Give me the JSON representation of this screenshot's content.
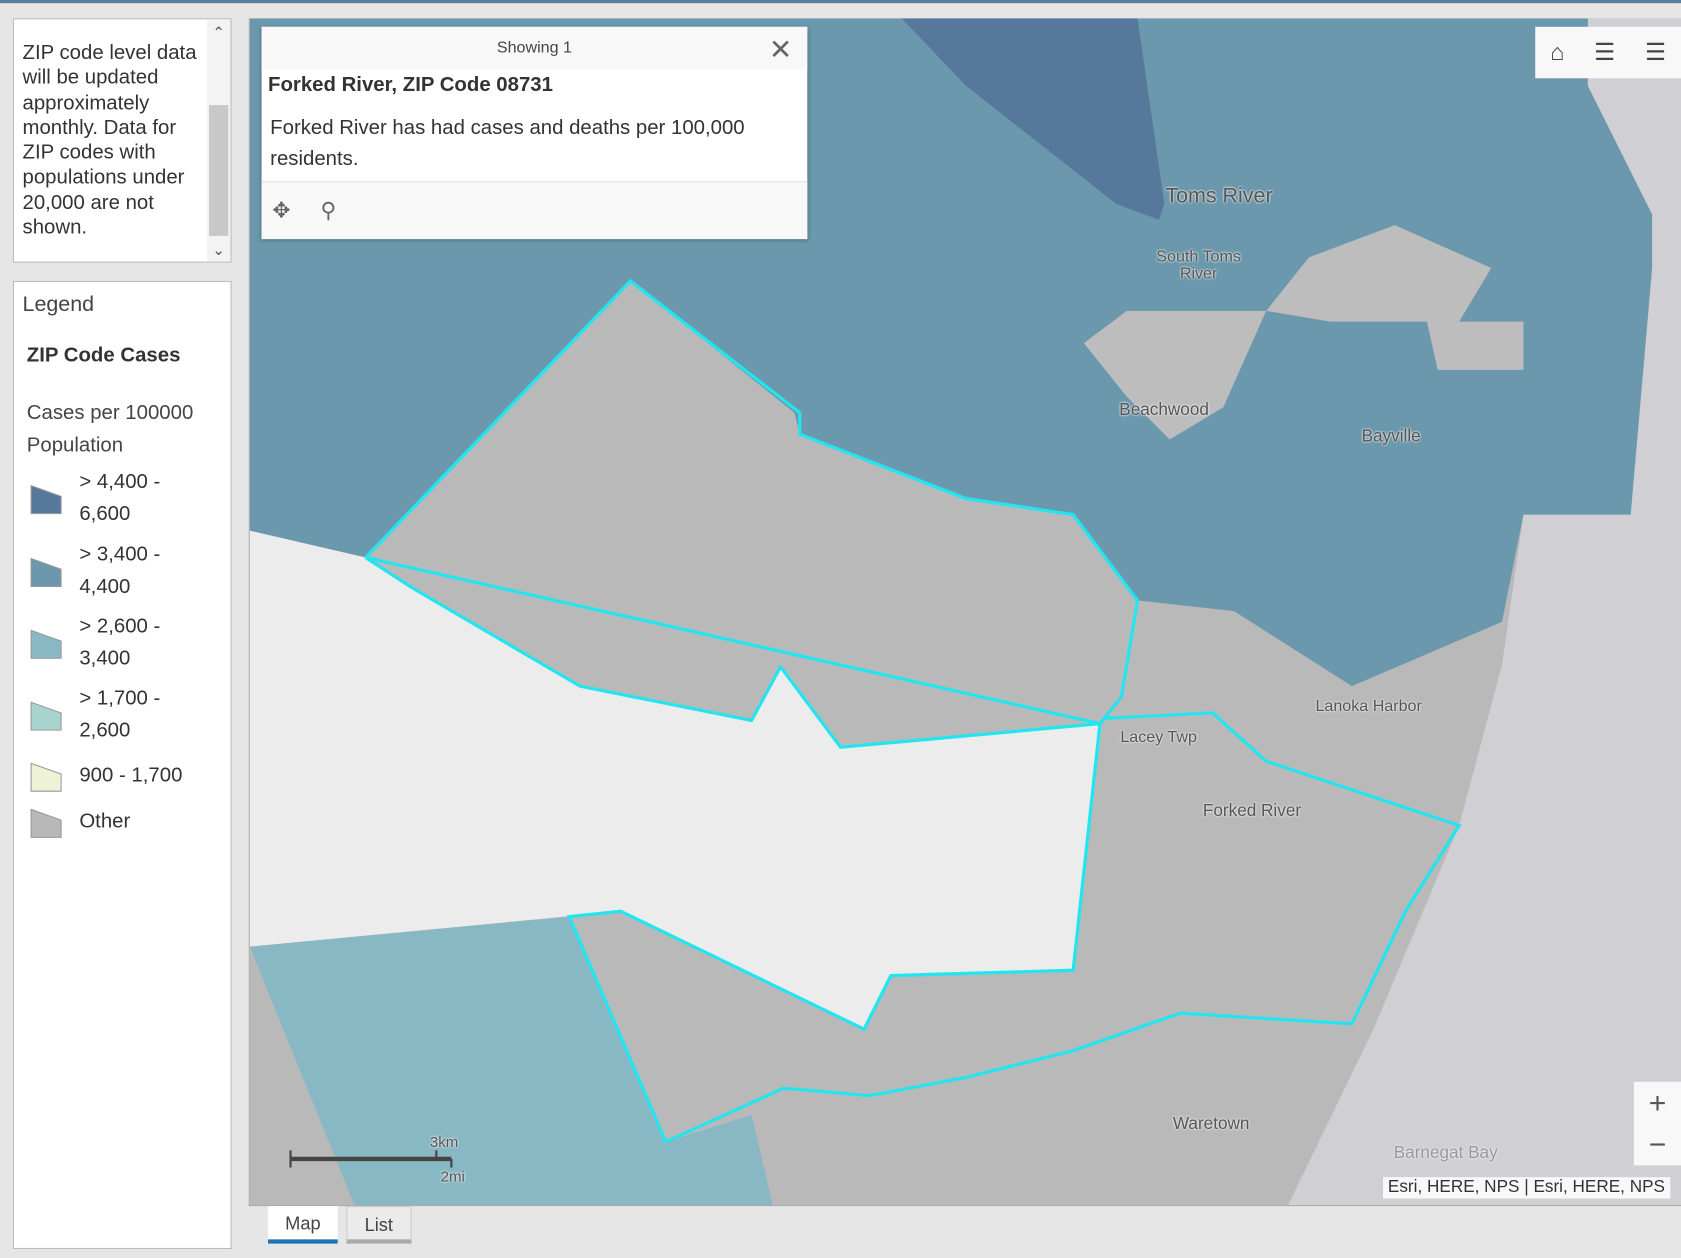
{
  "description": {
    "text": "ZIP code level data will be updated approximately monthly. Data for ZIP codes with populations under 20,000 are not shown."
  },
  "legend": {
    "title": "Legend",
    "layer": "ZIP Code Cases",
    "field": "Cases per 100000 Population",
    "items": [
      {
        "label": "> 4,400 - 6,600",
        "color": "#56789a"
      },
      {
        "label": "> 3,400 - 4,400",
        "color": "#6b98ad"
      },
      {
        "label": "> 2,600 - 3,400",
        "color": "#88b8c4"
      },
      {
        "label": "> 1,700 - 2,600",
        "color": "#a9d3cf"
      },
      {
        "label": "900 - 1,700",
        "color": "#eef2d6"
      },
      {
        "label": "Other",
        "color": "#b8b8b8"
      }
    ]
  },
  "popup": {
    "header": "Showing 1",
    "title": "Forked River, ZIP Code 08731",
    "body": "Forked River has had cases and  deaths per 100,000 residents."
  },
  "map": {
    "labels": [
      "Toms River",
      "South Toms River",
      "Beachwood",
      "Bayville",
      "Lanoka Harbor",
      "Lacey Twp",
      "Forked River",
      "Waretown",
      "Barnegat Bay"
    ],
    "scale_km": "3km",
    "scale_mi": "2mi",
    "attribution": "Esri, HERE, NPS | Esri, HERE, NPS",
    "highlight_color": "#22e5f0"
  },
  "tabs": [
    {
      "label": "Map"
    },
    {
      "label": "List"
    }
  ]
}
